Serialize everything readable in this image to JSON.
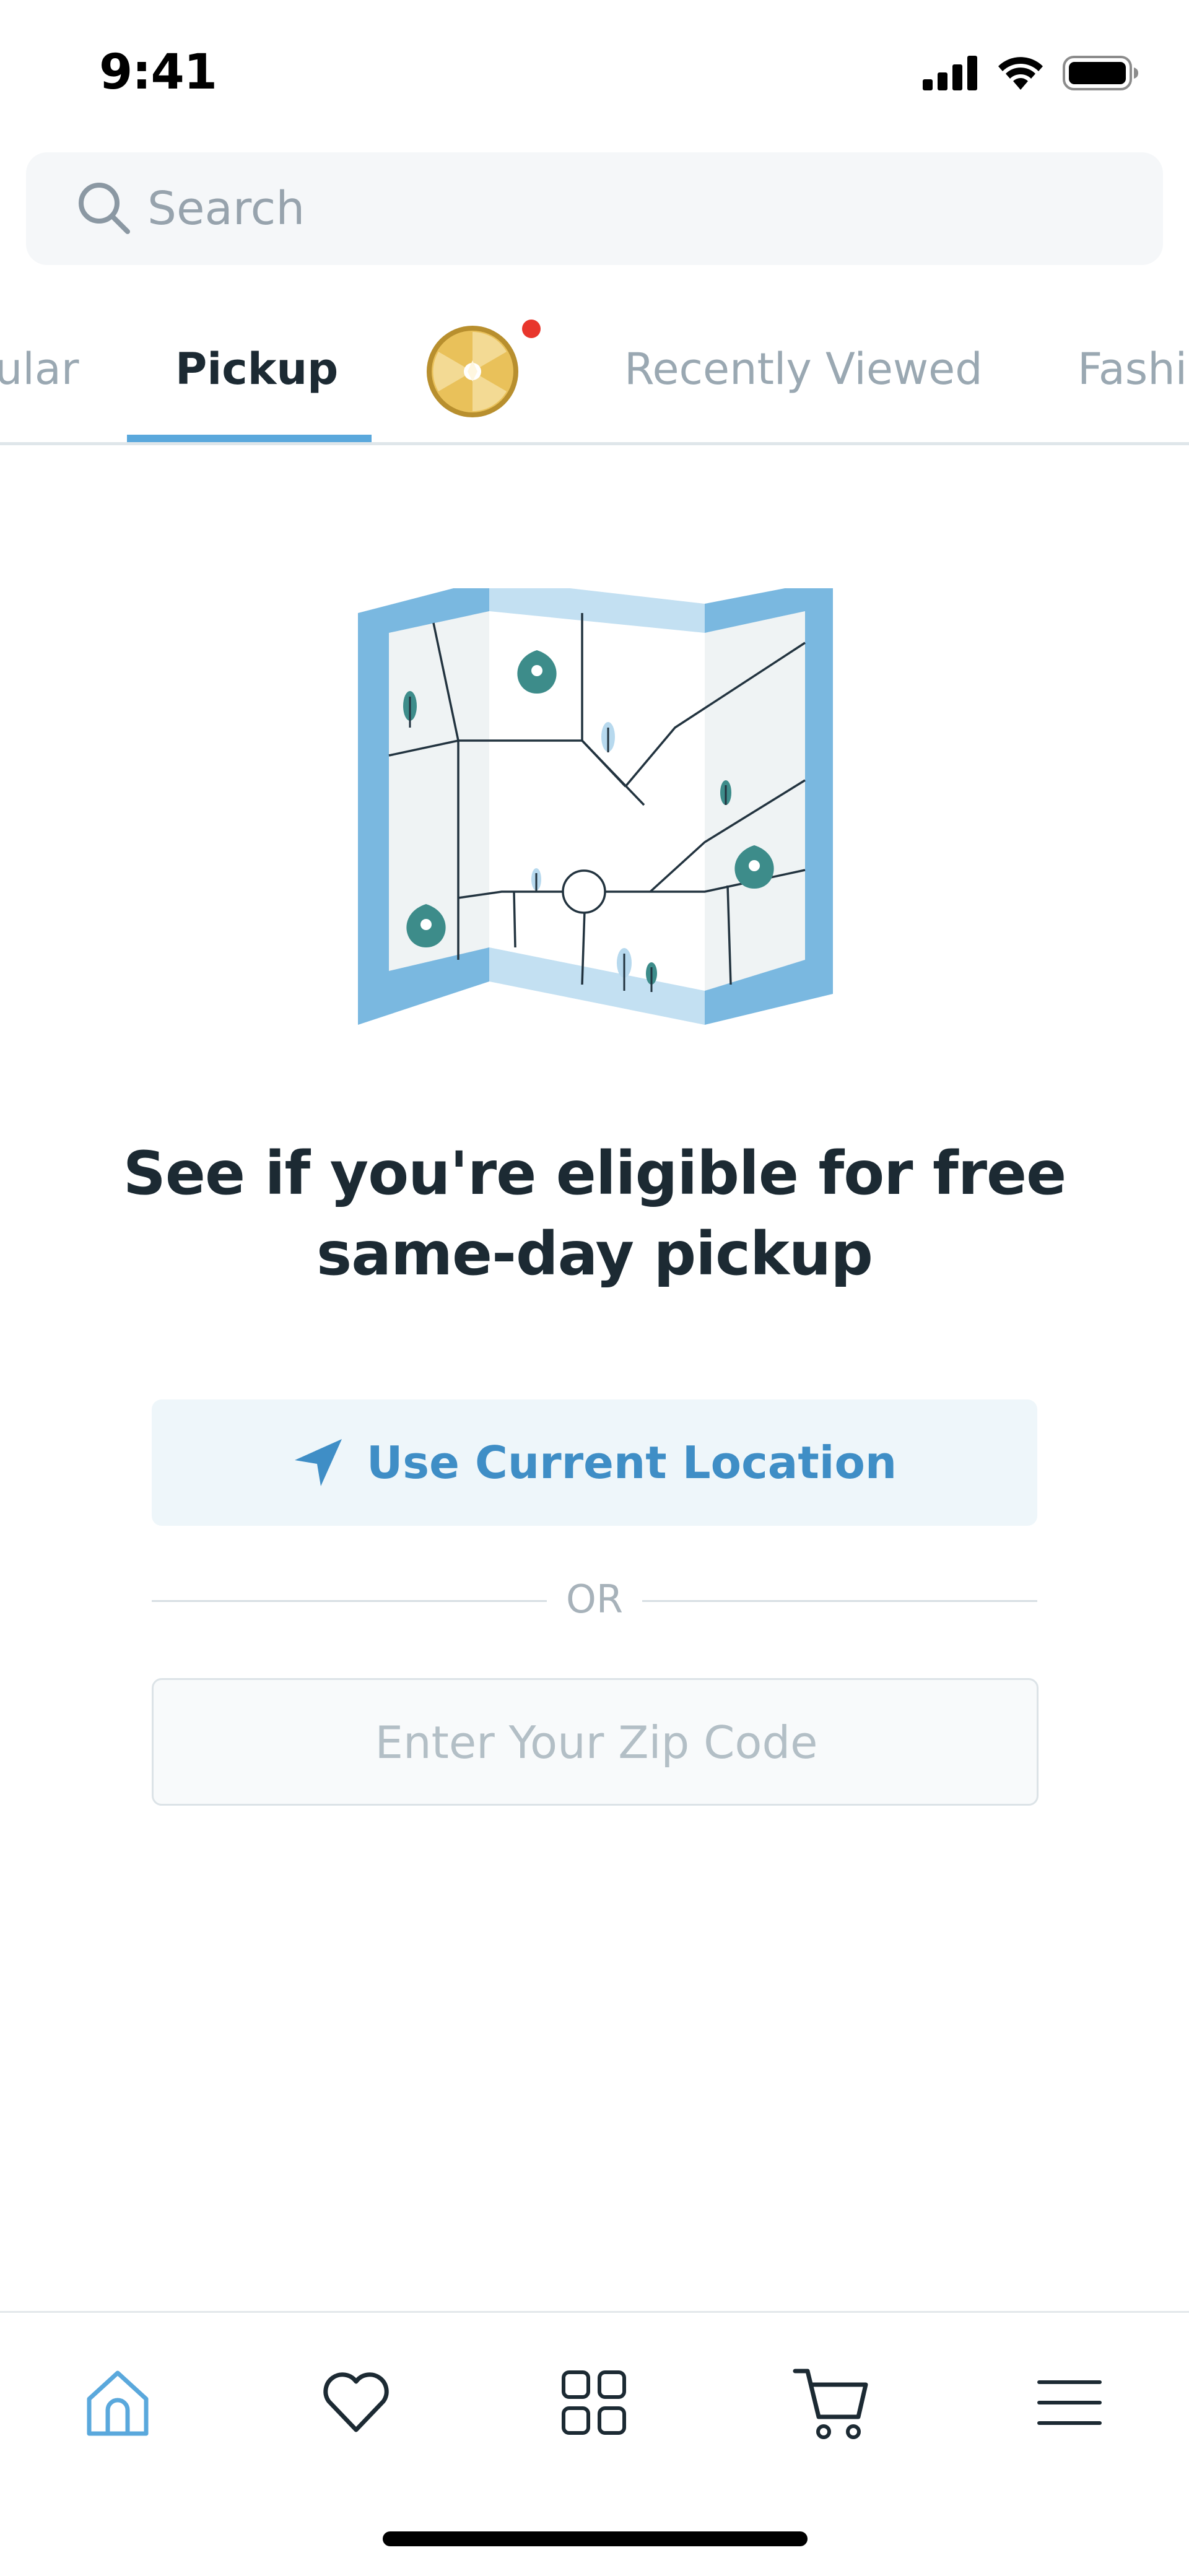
{
  "status_bar": {
    "time": "9:41",
    "icons": [
      "signal-icon",
      "wifi-icon",
      "battery-icon"
    ]
  },
  "search": {
    "placeholder": "Search",
    "icon": "search-icon"
  },
  "tabs": [
    {
      "label": "ular",
      "active": false
    },
    {
      "label": "Pickup",
      "active": true
    },
    {
      "label": "",
      "icon": "promo-badge-icon",
      "notification_dot": true
    },
    {
      "label": "Recently Viewed",
      "active": false
    },
    {
      "label": "Fashi",
      "active": false
    }
  ],
  "pickup": {
    "illustration": "folded-map-illustration",
    "headline_line1": "See if you're eligible for free",
    "headline_line2": "same-day pickup",
    "location_button_label": "Use Current Location",
    "location_icon": "location-arrow-icon",
    "divider_text": "OR",
    "zip_placeholder": "Enter Your Zip Code"
  },
  "bottom_nav": [
    {
      "name": "home",
      "icon": "home-icon",
      "active": true
    },
    {
      "name": "favorites",
      "icon": "heart-icon",
      "active": false
    },
    {
      "name": "categories",
      "icon": "grid-icon",
      "active": false
    },
    {
      "name": "cart",
      "icon": "cart-icon",
      "active": false
    },
    {
      "name": "menu",
      "icon": "menu-icon",
      "active": false
    }
  ],
  "colors": {
    "accent": "#5aa8dc",
    "accent_text": "#3f8ec6",
    "map_pin": "#3d8c8a",
    "notification": "#e8362c",
    "text_primary": "#1c2a33",
    "text_muted": "#9aa8b2"
  }
}
